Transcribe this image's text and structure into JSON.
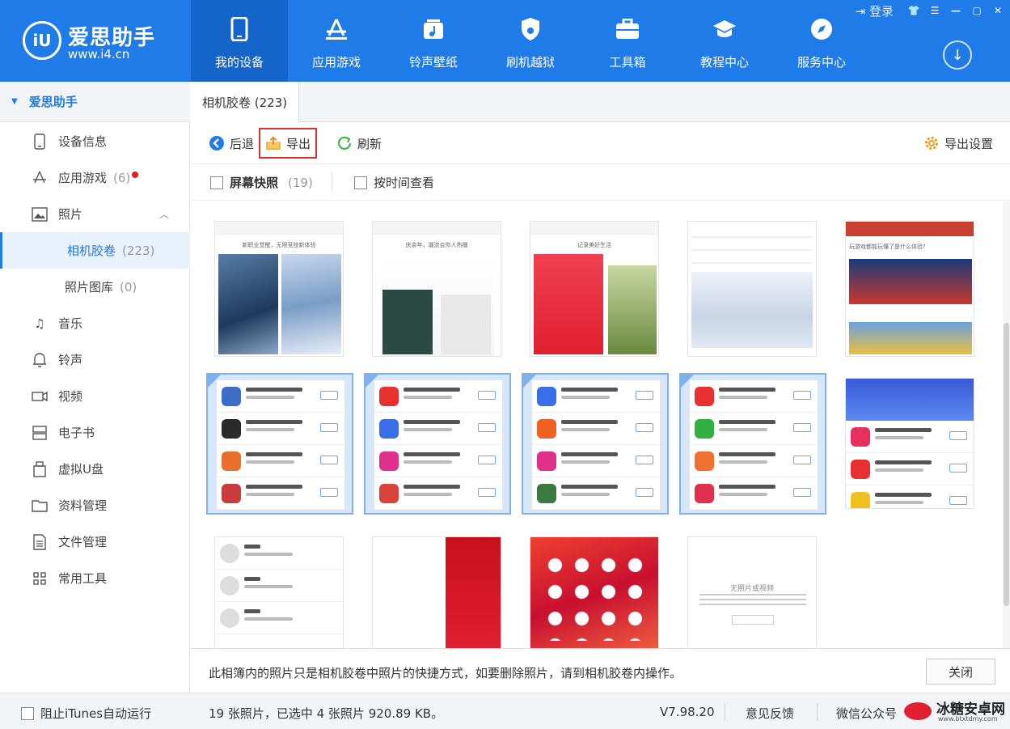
{
  "app": {
    "name": "爱思助手",
    "url": "www.i4.cn",
    "logo_text": "iU"
  },
  "nav": [
    {
      "label": "我的设备",
      "icon": "phone-icon",
      "active": true
    },
    {
      "label": "应用游戏",
      "icon": "app-store-icon"
    },
    {
      "label": "铃声壁纸",
      "icon": "music-note-icon"
    },
    {
      "label": "刷机越狱",
      "icon": "shield-icon"
    },
    {
      "label": "工具箱",
      "icon": "toolbox-icon"
    },
    {
      "label": "教程中心",
      "icon": "graduation-cap-icon"
    },
    {
      "label": "服务中心",
      "icon": "compass-icon"
    }
  ],
  "window": {
    "login": "登录"
  },
  "sidebar": {
    "header": "爱思助手",
    "items": [
      {
        "label": "设备信息",
        "icon": "device-info-icon"
      },
      {
        "label": "应用游戏",
        "count": "(6)",
        "icon": "app-store-icon",
        "badge": true
      },
      {
        "label": "照片",
        "icon": "photo-icon",
        "expanded": true
      },
      {
        "label": "相机胶卷",
        "count": "(223)",
        "sub": true,
        "selected": true
      },
      {
        "label": "照片图库",
        "count": "(0)",
        "sub": true
      },
      {
        "label": "音乐",
        "icon": "music-icon"
      },
      {
        "label": "铃声",
        "icon": "bell-icon"
      },
      {
        "label": "视频",
        "icon": "video-icon"
      },
      {
        "label": "电子书",
        "icon": "ebook-icon"
      },
      {
        "label": "虚拟U盘",
        "icon": "usb-drive-icon"
      },
      {
        "label": "资料管理",
        "icon": "folder-icon"
      },
      {
        "label": "文件管理",
        "icon": "file-icon"
      },
      {
        "label": "常用工具",
        "icon": "grid-icon"
      }
    ]
  },
  "tabs": [
    {
      "label": "相机胶卷 (223)"
    }
  ],
  "toolbar": {
    "back": "后退",
    "export": "导出",
    "refresh": "刷新",
    "export_settings": "导出设置"
  },
  "filters": {
    "screenshots": "屏幕快照",
    "screenshots_count": "(19)",
    "by_time": "按时间查看"
  },
  "photos": [
    {
      "caption": "新职业觉醒，无限竞技新体验",
      "selected": false
    },
    {
      "caption": "庆余年，潮流会你人热播",
      "selected": false
    },
    {
      "caption": "记录美好生活",
      "selected": false
    },
    {
      "caption": "",
      "selected": false
    },
    {
      "caption": "玩游戏都能玩懂了是什么体验?",
      "selected": false
    },
    {
      "caption": "",
      "selected": true
    },
    {
      "caption": "",
      "selected": true
    },
    {
      "caption": "",
      "selected": true
    },
    {
      "caption": "",
      "selected": true
    },
    {
      "caption": "",
      "selected": false
    },
    {
      "caption": "",
      "selected": false
    },
    {
      "caption": "",
      "selected": false
    },
    {
      "caption": "",
      "selected": false
    },
    {
      "caption": "无照片或视频",
      "selected": false
    }
  ],
  "notice": {
    "text": "此相簿内的照片只是相机胶卷中照片的快捷方式，如要删除照片，请到相机胶卷内操作。",
    "close": "关闭"
  },
  "status": {
    "itunes": "阻止iTunes自动运行",
    "summary": "19 张照片，已选中 4 张照片 920.89 KB。",
    "version": "V7.98.20",
    "feedback": "意见反馈",
    "wechat": "微信公众号",
    "watermark": "冰糖安卓网",
    "watermark_url": "www.btxtdmy.com"
  },
  "colors": {
    "brand": "#1e7be8",
    "selected_border": "#7fb1ee",
    "export_highlight": "#d93030"
  }
}
